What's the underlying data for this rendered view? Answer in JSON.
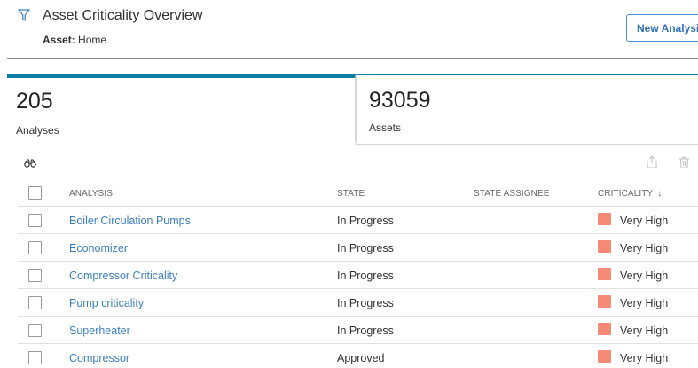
{
  "header": {
    "title": "Asset Criticality Overview",
    "asset_label": "Asset:",
    "asset_value": "Home",
    "new_button": "New Analysis"
  },
  "cards": {
    "analyses": {
      "count": "205",
      "label": "Analyses"
    },
    "assets": {
      "count": "93059",
      "label": "Assets"
    }
  },
  "table": {
    "columns": [
      "ANALYSIS",
      "STATE",
      "STATE ASSIGNEE",
      "CRITICALITY"
    ],
    "sort_indicator": "↓",
    "rows": [
      {
        "analysis": "Boiler Circulation Pumps",
        "state": "In Progress",
        "assignee": "",
        "criticality": "Very High"
      },
      {
        "analysis": "Economizer",
        "state": "In Progress",
        "assignee": "",
        "criticality": "Very High"
      },
      {
        "analysis": "Compressor Criticality",
        "state": "In Progress",
        "assignee": "",
        "criticality": "Very High"
      },
      {
        "analysis": "Pump criticality",
        "state": "In Progress",
        "assignee": "",
        "criticality": "Very High"
      },
      {
        "analysis": "Superheater",
        "state": "In Progress",
        "assignee": "",
        "criticality": "Very High"
      },
      {
        "analysis": "Compressor",
        "state": "Approved",
        "assignee": "",
        "criticality": "Very High"
      }
    ]
  },
  "icons": {
    "filter": "filter-icon",
    "search": "binoculars-icon",
    "share": "share-icon",
    "delete": "trash-icon"
  },
  "colors": {
    "accent": "#0c7da3",
    "link": "#3b7fc4",
    "very_high": "#f58a76",
    "border": "#d8d8d8"
  }
}
